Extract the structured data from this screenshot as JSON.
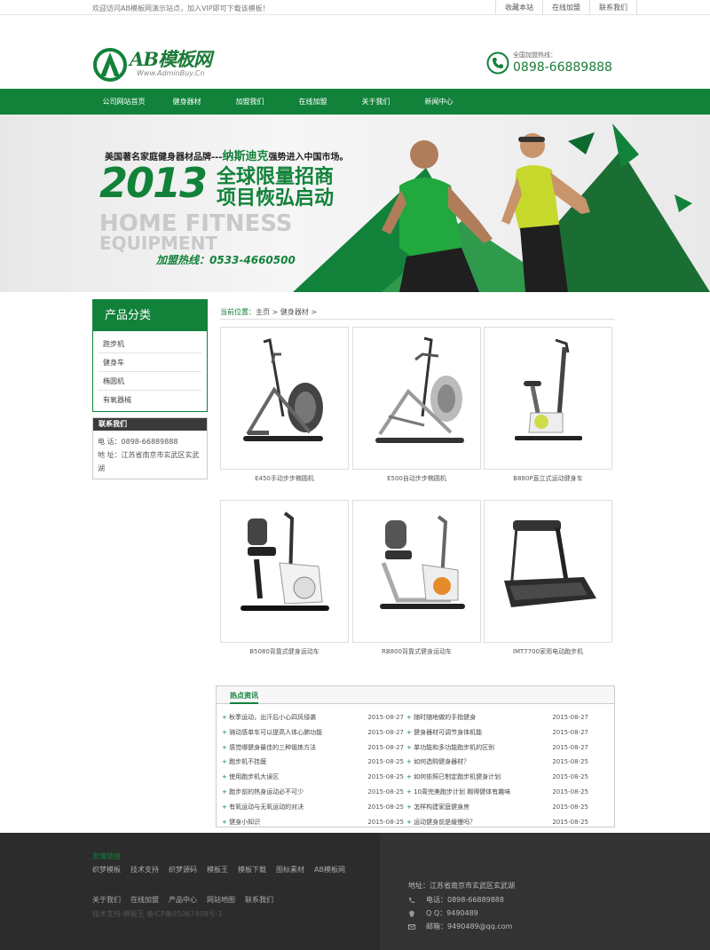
{
  "topbar": {
    "welcome": "欢迎访问AB模板网演示站点，加入VIP即可下载该模板！",
    "links": [
      "收藏本站",
      "在线加盟",
      "联系我们"
    ]
  },
  "header": {
    "logo_title": "AB模板网",
    "logo_sub": "Www.AdminBuy.Cn",
    "hotline_label": "全国加盟热线：",
    "hotline_number": "0898-66889888"
  },
  "nav": {
    "items": [
      "公司网站首页",
      "健身器材",
      "加盟我们",
      "在线加盟",
      "关于我们",
      "新闻中心"
    ]
  },
  "banner": {
    "line1_prefix": "美国著名家庭健身器材品牌---",
    "line1_brand": "纳斯迪克",
    "line1_suffix": "强势进入中国市场。",
    "year": "2013",
    "headline1": "全球限量招商",
    "headline2": "项目恢弘启动",
    "english1": "HOME FITNESS",
    "english2": "EQUIPMENT",
    "hotline": "加盟热线：0533-4660500"
  },
  "sidebar": {
    "category_title": "产品分类",
    "categories": [
      "跑步机",
      "健身车",
      "椭圆机",
      "有氧器械"
    ],
    "contact_title": "联系我们",
    "phone": "电 话：0898-66889888",
    "address": "地 址：江苏省南京市玄武区玄武湖"
  },
  "breadcrumb": {
    "label": "当前位置：",
    "path": "主页 > 健身器材 >"
  },
  "products": [
    {
      "name": "E450手动步步椭圆机"
    },
    {
      "name": "E500自动步步椭圆机"
    },
    {
      "name": "B880P直立式运动健身车"
    },
    {
      "name": "B5080背靠式健身运动车"
    },
    {
      "name": "RB800背靠式健身运动车"
    },
    {
      "name": "IMT7700家用电动跑步机"
    }
  ],
  "news": {
    "title": "热点资讯",
    "left": [
      {
        "title": "秋季运动，出汗后小心四风侵袭",
        "date": "2015-08-27"
      },
      {
        "title": "骑动感单车可以提高人体心肺功能",
        "date": "2015-08-27"
      },
      {
        "title": "感觉哪健身最佳的三种锻炼方法",
        "date": "2015-08-27"
      },
      {
        "title": "跑步机不挂膜",
        "date": "2015-08-25"
      },
      {
        "title": "使用跑步机大误区",
        "date": "2015-08-25"
      },
      {
        "title": "跑步前的热身运动必不可少",
        "date": "2015-08-25"
      },
      {
        "title": "有氧运动与无氧运动的对决",
        "date": "2015-08-25"
      },
      {
        "title": "健身小知识",
        "date": "2015-08-25"
      }
    ],
    "right": [
      {
        "title": "随时随地做的手指健身",
        "date": "2015-08-27"
      },
      {
        "title": "健身器材可调节身体机能",
        "date": "2015-08-27"
      },
      {
        "title": "单功能和多功能跑步机的区别",
        "date": "2015-08-27"
      },
      {
        "title": "如何选购健身器材？",
        "date": "2015-08-25"
      },
      {
        "title": "如何依照已制定跑步机健身计划",
        "date": "2015-08-25"
      },
      {
        "title": "10周完美跑步计划 踢得健体有趣味",
        "date": "2015-08-25"
      },
      {
        "title": "怎样构建家庭健身房",
        "date": "2015-08-25"
      },
      {
        "title": "运动健身前是缓慢吗？",
        "date": "2015-08-25"
      }
    ]
  },
  "footer": {
    "links_title": "友情链接",
    "links": [
      "织梦模板",
      "技术支持",
      "织梦源码",
      "模板王",
      "模板下载",
      "图标素材",
      "AB模板网"
    ],
    "bottom_links": [
      "关于我们",
      "在线加盟",
      "产品中心",
      "网站地图",
      "联系我们"
    ],
    "copyright": "技术支持:模板王   备ICP备05067408号-1",
    "address": "地址：江苏省南京市玄武区玄武湖",
    "phone": "电话：0898-66889888",
    "qq": "Q Q：9490489",
    "email": "邮箱：9490489@qq.com"
  },
  "colors": {
    "brand_green": "#12823a",
    "footer_dark": "#2c2c2c"
  }
}
